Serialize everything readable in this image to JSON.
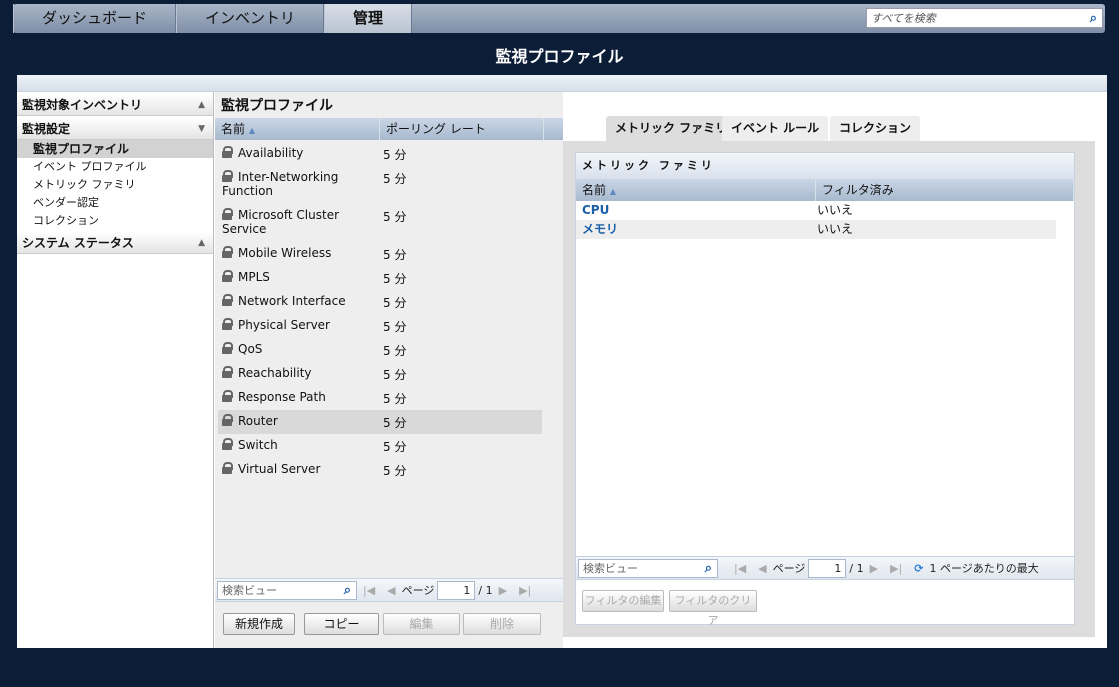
{
  "nav": {
    "tabs": [
      "ダッシュボード",
      "インベントリ",
      "管理"
    ],
    "active": 2,
    "search_placeholder": "すべてを検索"
  },
  "page_title": "監視プロファイル",
  "sidebar": {
    "sections": [
      {
        "label": "監視対象インベントリ",
        "arrow": "▲",
        "items": []
      },
      {
        "label": "監視設定",
        "arrow": "▼",
        "items": [
          "監視プロファイル",
          "イベント プロファイル",
          "メトリック ファミリ",
          "ベンダー認定",
          "コレクション"
        ]
      },
      {
        "label": "システム ステータス",
        "arrow": "▲",
        "items": []
      }
    ],
    "selected": "監視プロファイル"
  },
  "profiles": {
    "title": "監視プロファイル",
    "columns": [
      "名前",
      "ポーリング レート"
    ],
    "rows": [
      {
        "name": "Availability",
        "rate": "5 分"
      },
      {
        "name": "Inter-Networking Function",
        "rate": "5 分"
      },
      {
        "name": "Microsoft Cluster Service",
        "rate": "5 分"
      },
      {
        "name": "Mobile Wireless",
        "rate": "5 分"
      },
      {
        "name": "MPLS",
        "rate": "5 分"
      },
      {
        "name": "Network Interface",
        "rate": "5 分"
      },
      {
        "name": "Physical Server",
        "rate": "5 分"
      },
      {
        "name": "QoS",
        "rate": "5 分"
      },
      {
        "name": "Reachability",
        "rate": "5 分"
      },
      {
        "name": "Response Path",
        "rate": "5 分"
      },
      {
        "name": "Router",
        "rate": "5 分"
      },
      {
        "name": "Switch",
        "rate": "5 分"
      },
      {
        "name": "Virtual Server",
        "rate": "5 分"
      }
    ],
    "selected": "Router",
    "search_placeholder": "検索ビュー",
    "page_label": "ページ",
    "page": "1",
    "total": "/ 1",
    "buttons": [
      "新規作成",
      "コピー",
      "編集",
      "削除"
    ]
  },
  "detail": {
    "tabs": [
      "メトリック ファミリ",
      "イベント ルール",
      "コレクション"
    ],
    "active": 0,
    "panel_title": "メトリック ファミリ",
    "columns": [
      "名前",
      "フィルタ済み"
    ],
    "rows": [
      {
        "name": "CPU",
        "filtered": "いいえ"
      },
      {
        "name": "メモリ",
        "filtered": "いいえ"
      }
    ],
    "search_placeholder": "検索ビュー",
    "page_label": "ページ",
    "page": "1",
    "total": "/ 1",
    "per_page_label": "1 ページあたりの最大",
    "buttons": [
      "フィルタの編集",
      "フィルタのクリア"
    ]
  }
}
